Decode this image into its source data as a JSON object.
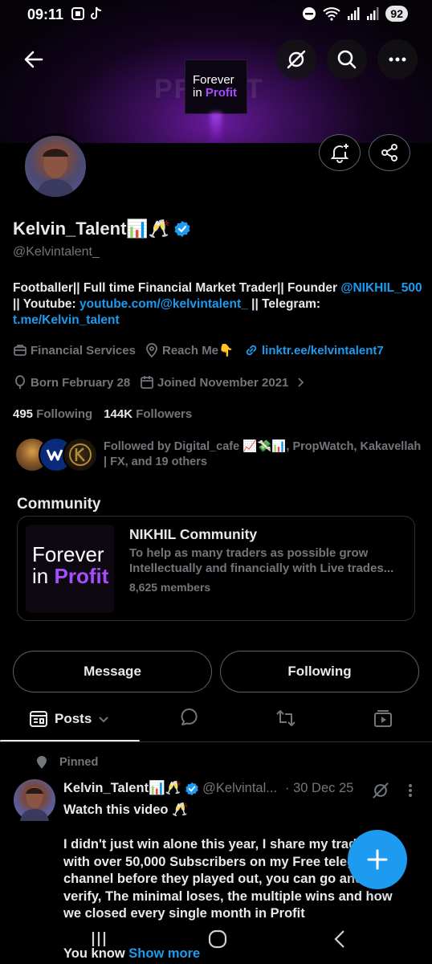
{
  "status_bar": {
    "time": "09:11",
    "battery": "92"
  },
  "banner": {
    "ghost_text": "PROFIT",
    "logo_line1": "Forever",
    "logo_line2a": "in",
    "logo_line2b": "Profit"
  },
  "profile": {
    "name": "Kelvin_Talent📊🥂",
    "handle": "@Kelvintalent_",
    "bio_part1": "Footballer|| Full time Financial Market Trader|| Founder ",
    "bio_link1": "@NIKHIL_500",
    "bio_part2": " || Youtube: ",
    "bio_link2": "youtube.com/@kelvintalent_",
    "bio_part3": " || Telegram: ",
    "bio_link3": "t.me/Kelvin_talent",
    "category": "Financial Services",
    "location": "Reach Me👇",
    "website": "linktr.ee/kelvintalent7",
    "born": "Born February 28",
    "joined": "Joined November 2021",
    "following_count": "495",
    "following_label": "Following",
    "followers_count": "144K",
    "followers_label": "Followers",
    "followed_by": "Followed by Digital_cafe 📈💸📊, PropWatch, Kakavellah | FX, and 19 others"
  },
  "community": {
    "section_title": "Community",
    "name": "NIKHIL Community",
    "description_line1": "To help as many traders as possible grow",
    "description_line2": "Intellectually and financially with Live trades...",
    "members": "8,625 members",
    "img_line1": "Forever",
    "img_line2a": "in",
    "img_line2b": "Profit"
  },
  "actions": {
    "message": "Message",
    "following": "Following"
  },
  "tabs": {
    "posts": "Posts"
  },
  "post": {
    "pinned_label": "Pinned",
    "author": "Kelvin_Talent📊🥂",
    "handle": "@Kelvintal...",
    "date": "· 30 Dec 25",
    "line1": "Watch this video 🥂",
    "body": "I didn't just win alone this year, I share my trades with over 50,000 Subscribers on my Free telegram channel before they played out, you can go and verify, The minimal loses, the multiple wins and how we closed every single month in Profit",
    "last_line": "You know",
    "show_more": "Show more"
  },
  "colors": {
    "accent": "#1d9bf0",
    "text": "#e7e9ea",
    "muted": "#71767b",
    "border": "#2f3336",
    "purple": "#a64dff"
  }
}
